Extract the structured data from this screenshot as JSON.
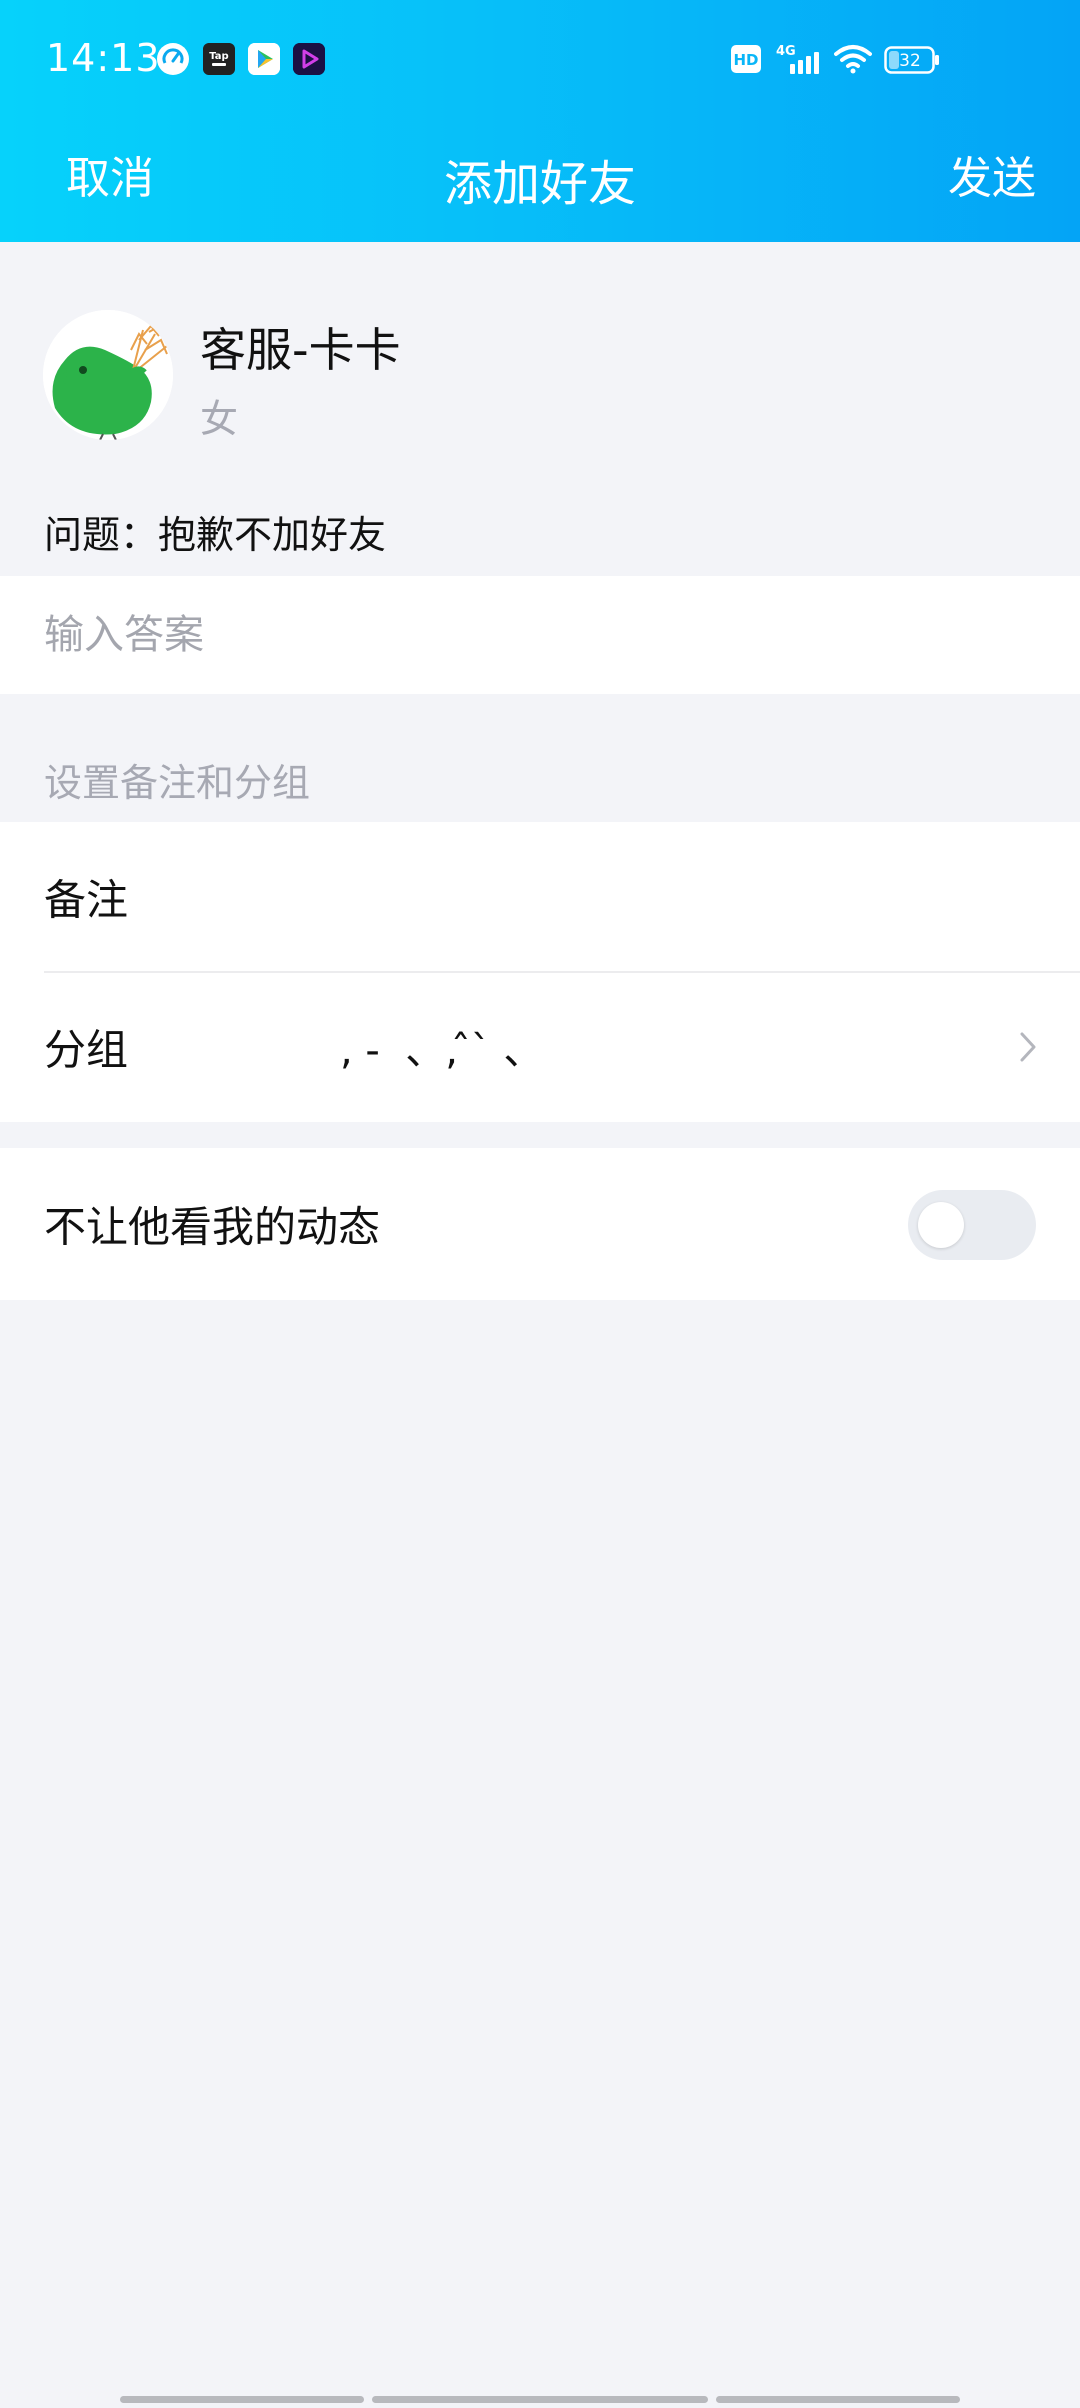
{
  "status_bar": {
    "time": "14:13",
    "app_icons": [
      "speedometer-icon",
      "taptap-icon",
      "video-play-icon",
      "purple-play-icon"
    ],
    "hd_label": "HD",
    "network_label": "4G",
    "battery_level": "32"
  },
  "nav": {
    "cancel_label": "取消",
    "title": "添加好友",
    "send_label": "发送"
  },
  "profile": {
    "name": "客服-卡卡",
    "gender": "女",
    "question": "问题：抱歉不加好友"
  },
  "answer": {
    "placeholder": "输入答案",
    "value": ""
  },
  "settings": {
    "section_label": "设置备注和分组",
    "remark_label": "备注",
    "group_label": "分组",
    "group_value": ", -  、, ̂` 、"
  },
  "privacy": {
    "hide_moments_label": "不让他看我的动态",
    "hide_moments_enabled": false
  },
  "colors": {
    "header_start": "#06d2fb",
    "header_end": "#04a4f6",
    "background": "#f3f4f8",
    "avatar_green": "#2cb34a"
  }
}
